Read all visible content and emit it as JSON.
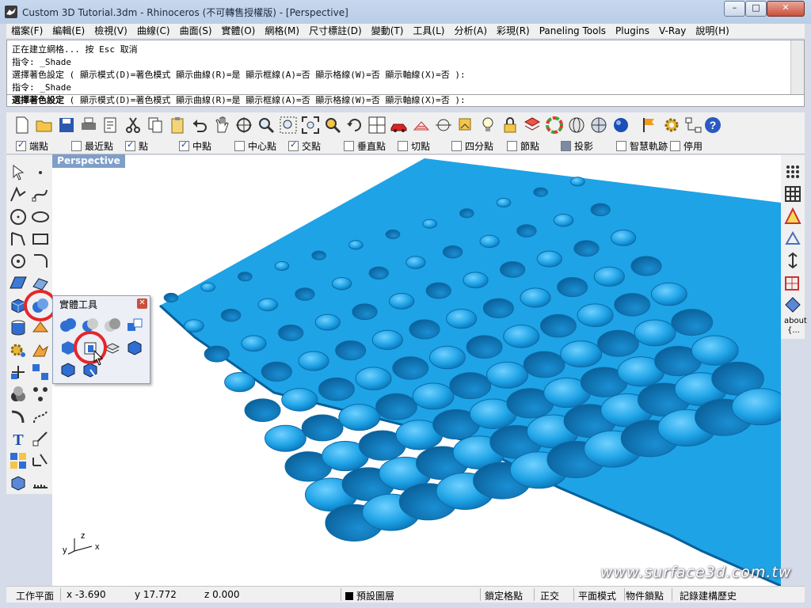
{
  "window": {
    "title": "Custom 3D Tutorial.3dm - Rhinoceros (不可轉售授權版) - [Perspective]",
    "minimize": "–",
    "maximize": "□",
    "close": "✕"
  },
  "menu": [
    "檔案(F)",
    "編輯(E)",
    "檢視(V)",
    "曲線(C)",
    "曲面(S)",
    "實體(O)",
    "網格(M)",
    "尺寸標註(D)",
    "變動(T)",
    "工具(L)",
    "分析(A)",
    "彩現(R)",
    "Paneling Tools",
    "Plugins",
    "V-Ray",
    "說明(H)"
  ],
  "command_history": [
    "正在建立網格... 按 Esc 取消",
    "指令: _Shade",
    "選擇著色設定 ( 顯示模式(D)=著色模式  顯示曲線(R)=是  顯示框線(A)=否  顯示格線(W)=否  顯示軸線(X)=否 ):",
    "指令: _Shade"
  ],
  "command_prompt": {
    "label": "選擇著色設定",
    "options": "( 顯示模式(D)=著色模式  顯示曲線(R)=是  顯示框線(A)=否  顯示格線(W)=否  顯示軸線(X)=否 ):"
  },
  "osnap": [
    {
      "label": "端點",
      "checked": true
    },
    {
      "label": "最近點",
      "checked": false
    },
    {
      "label": "點",
      "checked": true
    },
    {
      "label": "中點",
      "checked": true
    },
    {
      "label": "中心點",
      "checked": false
    },
    {
      "label": "交點",
      "checked": true
    },
    {
      "label": "垂直點",
      "checked": false
    },
    {
      "label": "切點",
      "checked": false
    },
    {
      "label": "四分點",
      "checked": false
    },
    {
      "label": "節點",
      "checked": false
    },
    {
      "label": "投影",
      "checked": false
    },
    {
      "label": "智慧軌跡",
      "checked": false
    },
    {
      "label": "停用",
      "checked": false
    }
  ],
  "viewport": {
    "tab": "Perspective",
    "axis_z": "z",
    "axis_y": "y",
    "axis_x": "x"
  },
  "palette": {
    "title": "實體工具",
    "close": "✕"
  },
  "right_toolbar": {
    "about_label": "about",
    "about_sub": "{..."
  },
  "status": {
    "cplane": "工作平面",
    "x": "x -3.690",
    "y": "y 17.772",
    "z": "z 0.000",
    "layer": "預設圖層",
    "grid_snap": "鎖定格點",
    "ortho": "正交",
    "planar": "平面模式",
    "osnap": "物件鎖點",
    "history": "記錄建構歷史"
  },
  "watermark": "www.surface3d.com.tw",
  "colors": {
    "surface": "#1ea3e6",
    "highlight_ring": "#e5262a",
    "viewport_tab": "#7f9ec9"
  }
}
